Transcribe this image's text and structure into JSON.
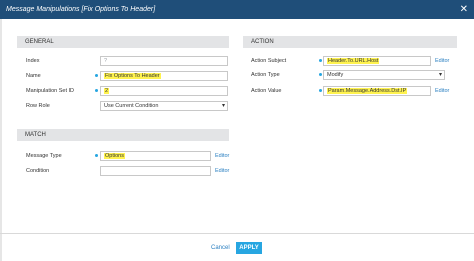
{
  "window": {
    "title": "Message Manipulations  [Fix Options To Header]",
    "close_glyph": "✕"
  },
  "general": {
    "heading": "GENERAL",
    "index": {
      "label": "Index",
      "value": "?"
    },
    "name": {
      "label": "Name",
      "value": "Fix Options To Header"
    },
    "set_id": {
      "label": "Manipulation Set ID",
      "value": "2"
    },
    "row_role": {
      "label": "Row Role",
      "value": "Use Current Condition"
    }
  },
  "action": {
    "heading": "ACTION",
    "subject": {
      "label": "Action Subject",
      "value": "Header.To.URL.Host",
      "editor": "Editor"
    },
    "type": {
      "label": "Action Type",
      "value": "Modify"
    },
    "value": {
      "label": "Action Value",
      "value": "Param.Message.Address.Dst.IP",
      "editor": "Editor"
    }
  },
  "match": {
    "heading": "MATCH",
    "message_type": {
      "label": "Message Type",
      "value": "Options",
      "editor": "Editor"
    },
    "condition": {
      "label": "Condition",
      "value": "",
      "editor": "Editor"
    }
  },
  "footer": {
    "cancel": "Cancel",
    "apply": "APPLY"
  },
  "colors": {
    "titlebar": "#1f4e79",
    "accent": "#27a6e1",
    "highlight": "#fff34f",
    "link": "#2a7fc1"
  }
}
